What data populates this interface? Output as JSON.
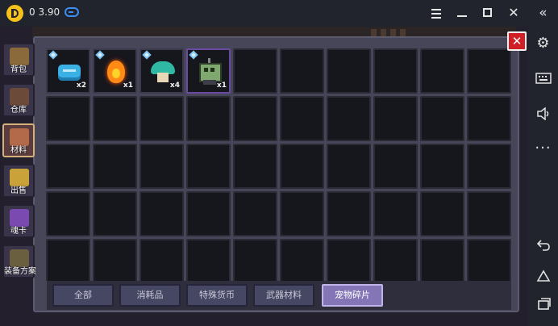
{
  "emulator": {
    "version": "0 3.90",
    "logo_icon": "app-logo-icon",
    "gamepad_icon": "gamepad-icon",
    "controls": [
      "menu-icon",
      "minimize-icon",
      "maximize-icon",
      "close-icon"
    ],
    "sidebar_icons": [
      "collapse-chevrons-icon",
      "settings-icon",
      "keyboard-icon",
      "volume-icon",
      "more-icon",
      "back-icon",
      "home-icon",
      "recent-apps-icon"
    ]
  },
  "categories": [
    {
      "label": "背包",
      "icon": "backpack-icon",
      "color": "#8a6a3a",
      "active": false
    },
    {
      "label": "仓库",
      "icon": "warehouse-icon",
      "color": "#6b4a3a",
      "active": false
    },
    {
      "label": "材料",
      "icon": "materials-icon",
      "color": "#b26a4a",
      "active": true
    },
    {
      "label": "出售",
      "icon": "sell-icon",
      "color": "#c9a23a",
      "active": false
    },
    {
      "label": "魂卡",
      "icon": "soul-card-icon",
      "color": "#7a4ab0",
      "active": false
    },
    {
      "label": "装备方案",
      "icon": "equipment-plan-icon",
      "color": "#6a6040",
      "active": false
    }
  ],
  "items": [
    {
      "name": "blue-slime-fragment",
      "icon": "slime-icon",
      "count": "x2"
    },
    {
      "name": "fire-spirit-fragment",
      "icon": "fire-spirit-icon",
      "count": "x1"
    },
    {
      "name": "mushroom-fragment",
      "icon": "mushroom-icon",
      "count": "x4"
    },
    {
      "name": "zombie-fragment",
      "icon": "zombie-icon",
      "count": "x1"
    }
  ],
  "close_label": "✕",
  "tabs": [
    {
      "label": "全部",
      "active": false
    },
    {
      "label": "消耗品",
      "active": false
    },
    {
      "label": "特殊货币",
      "active": false
    },
    {
      "label": "武器材料",
      "active": false
    },
    {
      "label": "宠物碎片",
      "active": true
    }
  ],
  "colors": {
    "panel": "#474658",
    "slot": "#16161d",
    "active_tab": "#8476b6",
    "close_button": "#d11f26",
    "accent_blue": "#3b8df1"
  }
}
